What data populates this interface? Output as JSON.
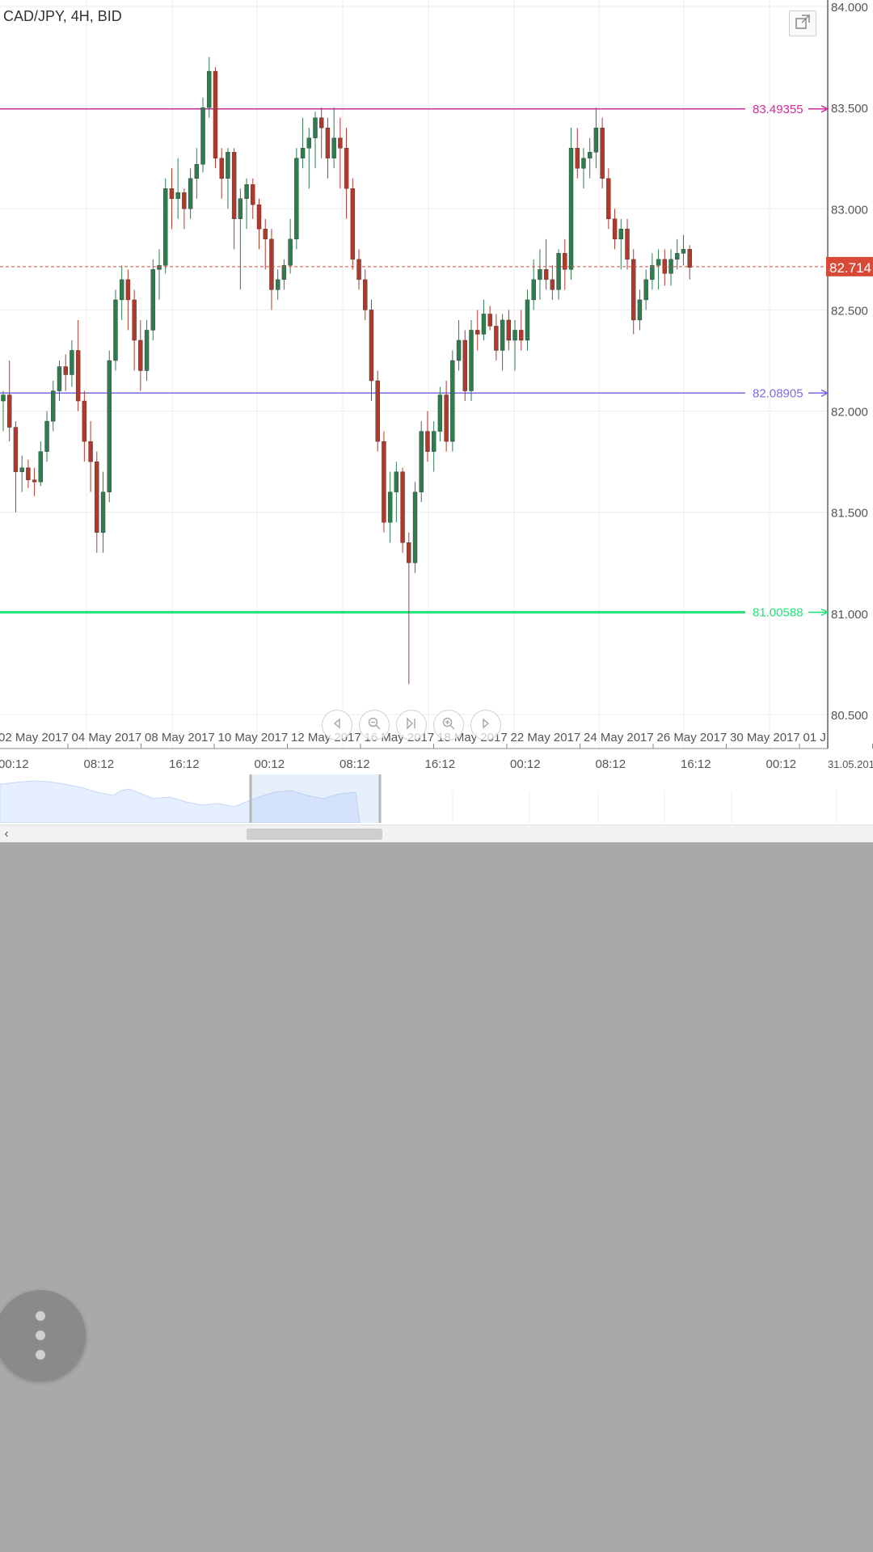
{
  "header": {
    "title": "CAD/JPY, 4H, BID"
  },
  "price_axis": {
    "ticks": [
      "84.000",
      "83.500",
      "83.000",
      "82.500",
      "82.000",
      "81.500",
      "81.000",
      "80.500"
    ],
    "current_price_label": "82.714",
    "current_price_color": "#d84a38"
  },
  "horizontal_lines": [
    {
      "label": "83.49355",
      "value": 83.49355,
      "color": "#cc2f9c"
    },
    {
      "label": "82.08905",
      "value": 82.08905,
      "color": "#7a6be0"
    },
    {
      "label": "81.00588",
      "value": 81.00588,
      "color": "#22e37a"
    }
  ],
  "date_axis": {
    "dates": [
      "02 May 2017",
      "04 May 2017",
      "08 May 2017",
      "10 May 2017",
      "12 May 2017",
      "16 May 2017",
      "18 May 2017",
      "22 May 2017",
      "24 May 2017",
      "26 May 2017",
      "30 May 2017",
      "01 J"
    ],
    "times": [
      "00:12",
      "08:12",
      "16:12",
      "00:12",
      "08:12",
      "16:12",
      "00:12",
      "08:12",
      "16:12",
      "00:12"
    ],
    "right_label": "31.05.201"
  },
  "nav_controls": [
    "back-icon",
    "zoom-out-icon",
    "jump-latest-icon",
    "zoom-in-icon",
    "forward-icon"
  ],
  "colors": {
    "bull": "#2e7d4f",
    "bear": "#b0392c",
    "grid": "#ececec"
  },
  "chart_data": {
    "type": "candlestick",
    "ylim": [
      80.5,
      84.0
    ],
    "candles": [
      [
        82.05,
        82.1,
        81.9,
        82.08
      ],
      [
        82.08,
        82.25,
        81.85,
        81.92
      ],
      [
        81.92,
        81.95,
        81.5,
        81.7
      ],
      [
        81.7,
        81.78,
        81.6,
        81.72
      ],
      [
        81.72,
        81.76,
        81.62,
        81.66
      ],
      [
        81.66,
        81.72,
        81.58,
        81.65
      ],
      [
        81.65,
        81.85,
        81.63,
        81.8
      ],
      [
        81.8,
        82.0,
        81.75,
        81.95
      ],
      [
        81.95,
        82.15,
        81.9,
        82.1
      ],
      [
        82.1,
        82.25,
        82.05,
        82.22
      ],
      [
        82.22,
        82.28,
        82.1,
        82.18
      ],
      [
        82.18,
        82.35,
        82.12,
        82.3
      ],
      [
        82.3,
        82.45,
        82.0,
        82.05
      ],
      [
        82.05,
        82.1,
        81.75,
        81.85
      ],
      [
        81.85,
        81.95,
        81.6,
        81.75
      ],
      [
        81.75,
        81.8,
        81.3,
        81.4
      ],
      [
        81.4,
        81.7,
        81.3,
        81.6
      ],
      [
        81.6,
        82.3,
        81.55,
        82.25
      ],
      [
        82.25,
        82.6,
        82.2,
        82.55
      ],
      [
        82.55,
        82.72,
        82.45,
        82.65
      ],
      [
        82.65,
        82.7,
        82.4,
        82.55
      ],
      [
        82.55,
        82.6,
        82.2,
        82.35
      ],
      [
        82.35,
        82.45,
        82.1,
        82.2
      ],
      [
        82.2,
        82.45,
        82.15,
        82.4
      ],
      [
        82.4,
        82.75,
        82.35,
        82.7
      ],
      [
        82.7,
        82.8,
        82.55,
        82.72
      ],
      [
        82.72,
        83.15,
        82.68,
        83.1
      ],
      [
        83.1,
        83.2,
        82.9,
        83.05
      ],
      [
        83.05,
        83.25,
        82.95,
        83.08
      ],
      [
        83.08,
        83.1,
        82.9,
        83.0
      ],
      [
        83.0,
        83.2,
        82.95,
        83.15
      ],
      [
        83.15,
        83.3,
        83.05,
        83.22
      ],
      [
        83.22,
        83.55,
        83.18,
        83.5
      ],
      [
        83.5,
        83.75,
        83.45,
        83.68
      ],
      [
        83.68,
        83.7,
        83.2,
        83.25
      ],
      [
        83.25,
        83.3,
        83.05,
        83.15
      ],
      [
        83.15,
        83.3,
        83.0,
        83.28
      ],
      [
        83.28,
        83.3,
        82.8,
        82.95
      ],
      [
        82.95,
        83.1,
        82.6,
        83.05
      ],
      [
        83.05,
        83.15,
        82.9,
        83.12
      ],
      [
        83.12,
        83.15,
        82.95,
        83.02
      ],
      [
        83.02,
        83.05,
        82.8,
        82.9
      ],
      [
        82.9,
        82.95,
        82.7,
        82.85
      ],
      [
        82.85,
        82.9,
        82.5,
        82.6
      ],
      [
        82.6,
        82.7,
        82.55,
        82.65
      ],
      [
        82.65,
        82.75,
        82.6,
        82.72
      ],
      [
        82.72,
        82.95,
        82.68,
        82.85
      ],
      [
        82.85,
        83.3,
        82.8,
        83.25
      ],
      [
        83.25,
        83.45,
        83.2,
        83.3
      ],
      [
        83.3,
        83.4,
        83.1,
        83.35
      ],
      [
        83.35,
        83.48,
        83.2,
        83.45
      ],
      [
        83.45,
        83.5,
        83.25,
        83.4
      ],
      [
        83.4,
        83.45,
        83.15,
        83.25
      ],
      [
        83.25,
        83.5,
        83.2,
        83.35
      ],
      [
        83.35,
        83.45,
        83.1,
        83.3
      ],
      [
        83.3,
        83.4,
        82.95,
        83.1
      ],
      [
        83.1,
        83.15,
        82.7,
        82.75
      ],
      [
        82.75,
        82.8,
        82.6,
        82.65
      ],
      [
        82.65,
        82.7,
        82.45,
        82.5
      ],
      [
        82.5,
        82.55,
        82.05,
        82.15
      ],
      [
        82.15,
        82.2,
        81.8,
        81.85
      ],
      [
        81.85,
        81.9,
        81.4,
        81.45
      ],
      [
        81.45,
        81.7,
        81.35,
        81.6
      ],
      [
        81.6,
        81.75,
        81.45,
        81.7
      ],
      [
        81.7,
        81.72,
        81.3,
        81.35
      ],
      [
        81.35,
        81.4,
        80.65,
        81.25
      ],
      [
        81.25,
        81.65,
        81.2,
        81.6
      ],
      [
        81.6,
        81.95,
        81.55,
        81.9
      ],
      [
        81.9,
        82.0,
        81.75,
        81.8
      ],
      [
        81.8,
        81.95,
        81.7,
        81.9
      ],
      [
        81.9,
        82.12,
        81.85,
        82.08
      ],
      [
        82.08,
        82.15,
        81.8,
        81.85
      ],
      [
        81.85,
        82.3,
        81.8,
        82.25
      ],
      [
        82.25,
        82.45,
        82.2,
        82.35
      ],
      [
        82.35,
        82.4,
        82.05,
        82.1
      ],
      [
        82.1,
        82.45,
        82.05,
        82.4
      ],
      [
        82.4,
        82.5,
        82.3,
        82.38
      ],
      [
        82.38,
        82.55,
        82.35,
        82.48
      ],
      [
        82.48,
        82.52,
        82.4,
        82.42
      ],
      [
        82.42,
        82.48,
        82.25,
        82.3
      ],
      [
        82.3,
        82.48,
        82.2,
        82.45
      ],
      [
        82.45,
        82.5,
        82.3,
        82.35
      ],
      [
        82.35,
        82.45,
        82.2,
        82.4
      ],
      [
        82.4,
        82.5,
        82.3,
        82.35
      ],
      [
        82.35,
        82.6,
        82.3,
        82.55
      ],
      [
        82.55,
        82.75,
        82.5,
        82.65
      ],
      [
        82.65,
        82.8,
        82.55,
        82.7
      ],
      [
        82.7,
        82.85,
        82.6,
        82.65
      ],
      [
        82.65,
        82.72,
        82.55,
        82.6
      ],
      [
        82.6,
        82.8,
        82.55,
        82.78
      ],
      [
        82.78,
        82.85,
        82.6,
        82.7
      ],
      [
        82.7,
        83.4,
        82.65,
        83.3
      ],
      [
        83.3,
        83.4,
        83.15,
        83.2
      ],
      [
        83.2,
        83.3,
        83.1,
        83.25
      ],
      [
        83.25,
        83.35,
        83.15,
        83.28
      ],
      [
        83.28,
        83.5,
        83.2,
        83.4
      ],
      [
        83.4,
        83.45,
        83.1,
        83.15
      ],
      [
        83.15,
        83.2,
        82.9,
        82.95
      ],
      [
        82.95,
        83.0,
        82.8,
        82.85
      ],
      [
        82.85,
        82.95,
        82.7,
        82.9
      ],
      [
        82.9,
        82.95,
        82.7,
        82.75
      ],
      [
        82.75,
        82.8,
        82.38,
        82.45
      ],
      [
        82.45,
        82.6,
        82.4,
        82.55
      ],
      [
        82.55,
        82.7,
        82.5,
        82.65
      ],
      [
        82.65,
        82.78,
        82.6,
        82.72
      ],
      [
        82.72,
        82.8,
        82.6,
        82.75
      ],
      [
        82.75,
        82.8,
        82.62,
        82.68
      ],
      [
        82.68,
        82.8,
        82.62,
        82.75
      ],
      [
        82.75,
        82.85,
        82.7,
        82.78
      ],
      [
        82.78,
        82.87,
        82.72,
        82.8
      ],
      [
        82.8,
        82.82,
        82.65,
        82.71
      ]
    ],
    "current_price": 82.714
  }
}
